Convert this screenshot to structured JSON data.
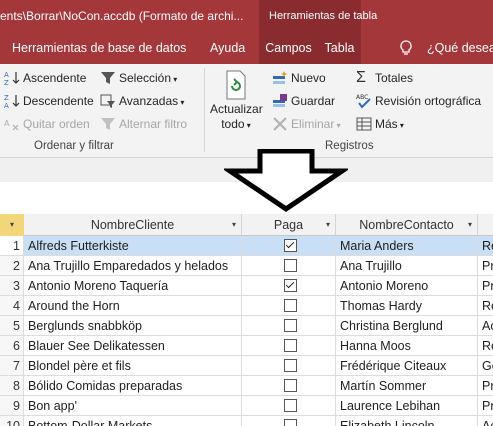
{
  "window": {
    "title": "ents\\Borrar\\NoCon.accdb (Formato de archi...",
    "context_tab_group": "Herramientas de tabla"
  },
  "ribbon_tabs": [
    {
      "label": "Herramientas de base de datos"
    },
    {
      "label": "Ayuda"
    },
    {
      "label": "Campos",
      "active": true
    },
    {
      "label": "Tabla"
    },
    {
      "label": "¿Qué desea h"
    }
  ],
  "ribbon": {
    "sort_filter": {
      "ascending": "Ascendente",
      "descending": "Descendente",
      "remove_sort": "Quitar orden",
      "selection": "Selección",
      "advanced": "Avanzadas",
      "toggle_filter": "Alternar filtro",
      "group_label": "Ordenar y filtrar"
    },
    "records": {
      "refresh_line1": "Actualizar",
      "refresh_line2": "todo",
      "new": "Nuevo",
      "save": "Guardar",
      "delete": "Eliminar",
      "totals": "Totales",
      "spelling": "Revisión ortográfica",
      "more": "Más",
      "group_label": "Registros"
    }
  },
  "table": {
    "columns": [
      "NombreCliente",
      "Paga",
      "NombreContacto"
    ],
    "rows": [
      {
        "n": "1",
        "cliente": "Alfreds Futterkiste",
        "paga": true,
        "contacto": "Maria Anders",
        "extra": "Re"
      },
      {
        "n": "2",
        "cliente": "Ana Trujillo Emparedados y helados",
        "paga": false,
        "contacto": "Ana Trujillo",
        "extra": "Pr"
      },
      {
        "n": "3",
        "cliente": "Antonio Moreno Taquería",
        "paga": true,
        "contacto": "Antonio Moreno",
        "extra": "Pr"
      },
      {
        "n": "4",
        "cliente": "Around the Horn",
        "paga": false,
        "contacto": "Thomas Hardy",
        "extra": "Re"
      },
      {
        "n": "5",
        "cliente": "Berglunds snabbköp",
        "paga": false,
        "contacto": "Christina Berglund",
        "extra": "Ac"
      },
      {
        "n": "6",
        "cliente": "Blauer See Delikatessen",
        "paga": false,
        "contacto": "Hanna Moos",
        "extra": "Re"
      },
      {
        "n": "7",
        "cliente": "Blondel père et fils",
        "paga": false,
        "contacto": "Frédérique Citeaux",
        "extra": "Ge"
      },
      {
        "n": "8",
        "cliente": "Bólido Comidas preparadas",
        "paga": false,
        "contacto": "Martín Sommer",
        "extra": "Pr"
      },
      {
        "n": "9",
        "cliente": "Bon app'",
        "paga": false,
        "contacto": "Laurence Lebihan",
        "extra": "Pr"
      },
      {
        "n": "10",
        "cliente": "Bottom-Dollar Markets",
        "paga": false,
        "contacto": "Elizabeth Lincoln",
        "extra": "Ac"
      }
    ]
  },
  "colors": {
    "title_bar": "#a4373a",
    "context_tab": "#8a2c2f",
    "selected_row": "#c9dff5",
    "selector_header": "#f3d57a"
  }
}
